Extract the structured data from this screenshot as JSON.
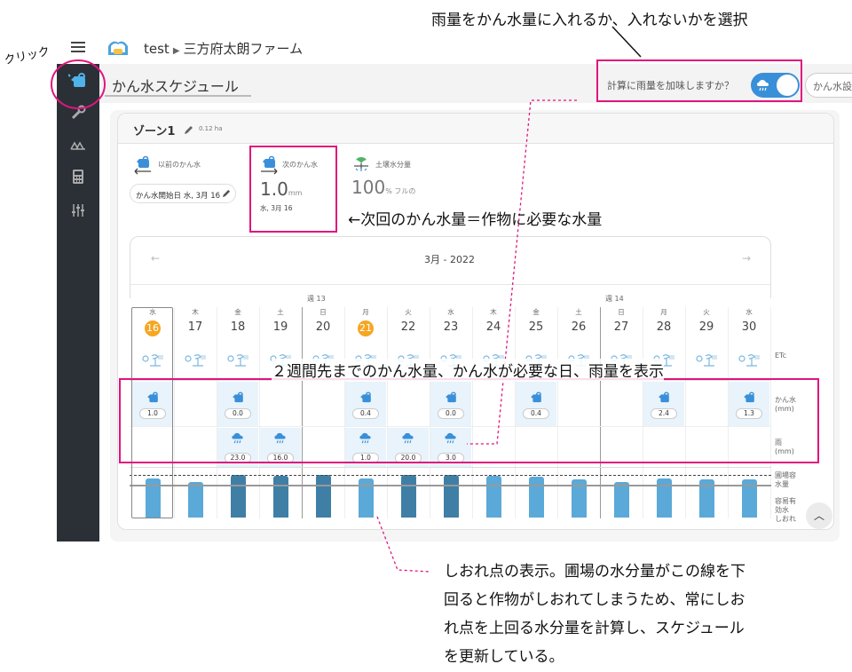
{
  "header": {
    "farm_name": "test",
    "breadcrumb_current": "三方府太朗ファーム"
  },
  "page": {
    "title": "かん水スケジュール",
    "rain_question": "計算に雨量を加味しますか？",
    "rain_toggle_on": true,
    "settings_button": "かん水設"
  },
  "zone": {
    "name": "ゾーン1",
    "area": "0.12 ha",
    "previous": {
      "label": "以前のかん水",
      "start_chip": "かん水開始日 水, 3月 16"
    },
    "next": {
      "label": "次のかん水",
      "value": "1.0",
      "unit": "mm",
      "date": "水, 3月 16"
    },
    "soil": {
      "label": "土壌水分量",
      "value": "100",
      "unit": "% フルの"
    }
  },
  "calendar": {
    "month": "3月 - 2022",
    "prev": "←",
    "next": "→",
    "weeks": [
      "週 13",
      "週 14"
    ],
    "days": [
      {
        "dow": "水",
        "dom": "16",
        "highlight": true,
        "watering": "1.0",
        "rain": "",
        "moisture": 0.74
      },
      {
        "dow": "木",
        "dom": "17",
        "highlight": false,
        "watering": "",
        "rain": "",
        "moisture": 0.66
      },
      {
        "dow": "金",
        "dom": "18",
        "highlight": false,
        "watering": "0.0",
        "rain": "23.0",
        "moisture": 0.8
      },
      {
        "dow": "土",
        "dom": "19",
        "highlight": false,
        "watering": "",
        "rain": "16.0",
        "moisture": 0.78
      },
      {
        "dow": "日",
        "dom": "20",
        "highlight": false,
        "watering": "",
        "rain": "",
        "moisture": 0.8
      },
      {
        "dow": "月",
        "dom": "21",
        "highlight": true,
        "watering": "0.4",
        "rain": "1.0",
        "moisture": 0.74
      },
      {
        "dow": "火",
        "dom": "22",
        "highlight": false,
        "watering": "",
        "rain": "20.0",
        "moisture": 0.8
      },
      {
        "dow": "水",
        "dom": "23",
        "highlight": false,
        "watering": "0.0",
        "rain": "3.0",
        "moisture": 0.8
      },
      {
        "dow": "木",
        "dom": "24",
        "highlight": false,
        "watering": "",
        "rain": "",
        "moisture": 0.78
      },
      {
        "dow": "金",
        "dom": "25",
        "highlight": false,
        "watering": "0.4",
        "rain": "",
        "moisture": 0.76
      },
      {
        "dow": "土",
        "dom": "26",
        "highlight": false,
        "watering": "",
        "rain": "",
        "moisture": 0.72
      },
      {
        "dow": "日",
        "dom": "27",
        "highlight": false,
        "watering": "",
        "rain": "",
        "moisture": 0.66
      },
      {
        "dow": "月",
        "dom": "28",
        "highlight": false,
        "watering": "2.4",
        "rain": "",
        "moisture": 0.74
      },
      {
        "dow": "火",
        "dom": "29",
        "highlight": false,
        "watering": "",
        "rain": "",
        "moisture": 0.72
      },
      {
        "dow": "水",
        "dom": "30",
        "highlight": false,
        "watering": "1.3",
        "rain": "",
        "moisture": 0.72
      }
    ],
    "row_labels": {
      "etc": "ETc",
      "watering": "かん水",
      "watering_unit": "(mm)",
      "rain": "雨",
      "rain_unit": "(mm)",
      "field_capacity": "圃場容水量",
      "readily_available": "容易有効水",
      "wilting": "しおれ"
    }
  },
  "annotations": {
    "click": "クリック",
    "rain_select": "雨量をかん水量に入れるか、入れないかを選択",
    "next_note": "←次回のかん水量＝作物に必要な水量",
    "two_weeks": "２週間先までのかん水量、かん水が必要な日、雨量を表示",
    "wilting_note": [
      "しおれ点の表示。圃場の水分量がこの線を下",
      "回ると作物がしおれてしまうため、常にしお",
      "れ点を上回る水分量を計算し、スケジュール",
      "を更新している。"
    ]
  },
  "colors": {
    "sidebar": "#2b3037",
    "accent": "#3a8fd9",
    "highlight_day": "#f5a623",
    "annotation": "#e0157e",
    "bar_light": "#5aa9d8",
    "bar_dark": "#3f7fa6"
  }
}
